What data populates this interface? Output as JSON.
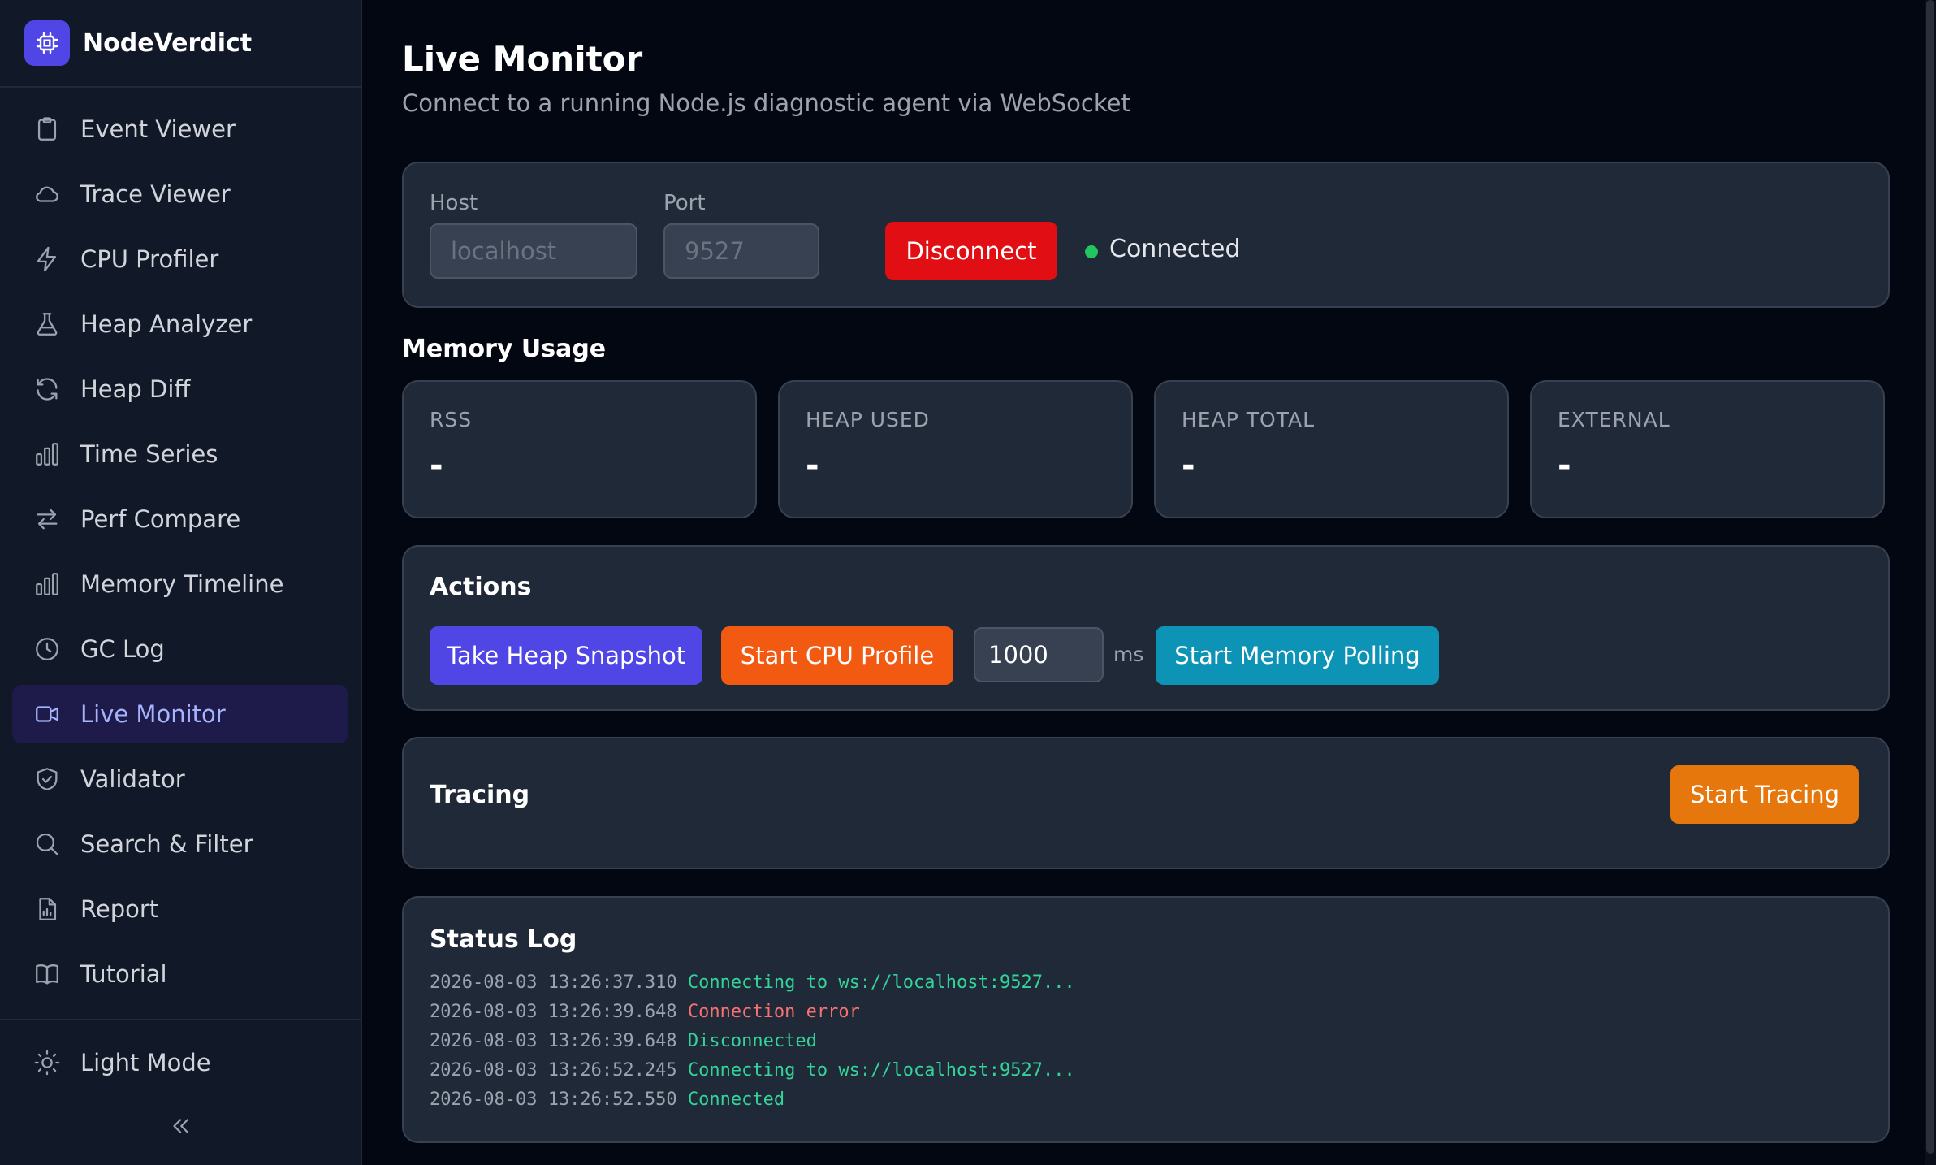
{
  "app": {
    "name": "NodeVerdict"
  },
  "sidebar": {
    "items": [
      {
        "label": "Event Viewer",
        "icon": "clipboard-icon"
      },
      {
        "label": "Trace Viewer",
        "icon": "cloud-icon"
      },
      {
        "label": "CPU Profiler",
        "icon": "bolt-icon"
      },
      {
        "label": "Heap Analyzer",
        "icon": "flask-icon"
      },
      {
        "label": "Heap Diff",
        "icon": "refresh-icon"
      },
      {
        "label": "Time Series",
        "icon": "bar-chart-icon"
      },
      {
        "label": "Perf Compare",
        "icon": "arrows-swap-icon"
      },
      {
        "label": "Memory Timeline",
        "icon": "bar-chart-icon"
      },
      {
        "label": "GC Log",
        "icon": "clock-icon"
      },
      {
        "label": "Live Monitor",
        "icon": "video-icon",
        "active": true
      },
      {
        "label": "Validator",
        "icon": "shield-check-icon"
      },
      {
        "label": "Search & Filter",
        "icon": "search-icon"
      },
      {
        "label": "Report",
        "icon": "document-chart-icon"
      },
      {
        "label": "Tutorial",
        "icon": "book-icon"
      }
    ],
    "theme_toggle": "Light Mode"
  },
  "main": {
    "title": "Live Monitor",
    "subtitle": "Connect to a running Node.js diagnostic agent via WebSocket",
    "connection": {
      "host_label": "Host",
      "host_value": "localhost",
      "port_label": "Port",
      "port_value": "9527",
      "disconnect_label": "Disconnect",
      "status": "Connected",
      "status_color": "#22c55e"
    },
    "memory": {
      "title": "Memory Usage",
      "stats": [
        {
          "label": "RSS",
          "value": "-"
        },
        {
          "label": "HEAP USED",
          "value": "-"
        },
        {
          "label": "HEAP TOTAL",
          "value": "-"
        },
        {
          "label": "EXTERNAL",
          "value": "-"
        }
      ]
    },
    "actions": {
      "title": "Actions",
      "heap_snapshot": "Take Heap Snapshot",
      "cpu_profile": "Start CPU Profile",
      "interval_value": "1000",
      "interval_unit": "ms",
      "memory_polling": "Start Memory Polling"
    },
    "tracing": {
      "title": "Tracing",
      "start_label": "Start Tracing"
    },
    "status_log": {
      "title": "Status Log",
      "entries": [
        {
          "timestamp": "2026-08-03 13:26:37.310",
          "message": "Connecting to ws://localhost:9527...",
          "level": "ok"
        },
        {
          "timestamp": "2026-08-03 13:26:39.648",
          "message": "Connection error",
          "level": "err"
        },
        {
          "timestamp": "2026-08-03 13:26:39.648",
          "message": "Disconnected",
          "level": "ok"
        },
        {
          "timestamp": "2026-08-03 13:26:52.245",
          "message": "Connecting to ws://localhost:9527...",
          "level": "ok"
        },
        {
          "timestamp": "2026-08-03 13:26:52.550",
          "message": "Connected",
          "level": "ok"
        }
      ]
    }
  },
  "colors": {
    "accent": "#4f46e5",
    "disconnect": "#e10f14",
    "cpu": "#f25a12",
    "polling": "#0d93b5",
    "tracing": "#e6770c"
  }
}
